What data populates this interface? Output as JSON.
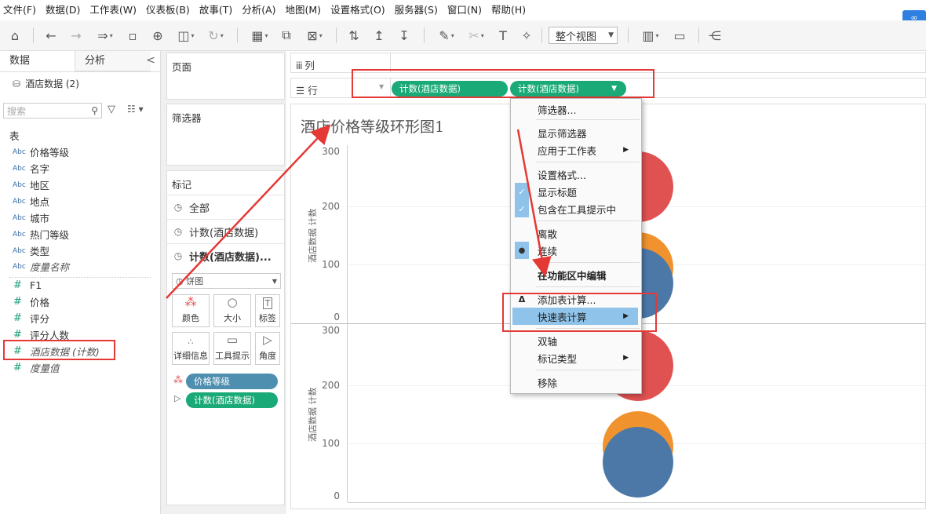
{
  "menubar": [
    "文件(F)",
    "数据(D)",
    "工作表(W)",
    "仪表板(B)",
    "故事(T)",
    "分析(A)",
    "地图(M)",
    "设置格式(O)",
    "服务器(S)",
    "窗口(N)",
    "帮助(H)"
  ],
  "toolbar": {
    "view_select": "整个视图",
    "icons": [
      "home-icon",
      "undo-icon",
      "redo-icon",
      "replay-icon",
      "save-icon",
      "new-datasource-icon",
      "datasource-icon",
      "refresh-icon",
      "new-worksheet-icon",
      "duplicate-icon",
      "clear-icon",
      "swap-icon",
      "sort-asc-icon",
      "sort-desc-icon",
      "highlight-icon",
      "attach-icon",
      "label-icon",
      "pin-icon",
      "showme-icon",
      "presentation-icon",
      "share-icon"
    ]
  },
  "leftpanel": {
    "tab_data": "数据",
    "tab_analysis": "分析",
    "collapse": "<",
    "datasource": "酒店数据 (2)",
    "search_placeholder": "搜索",
    "tables_label": "表",
    "dimensions": [
      {
        "type": "Abc",
        "name": "价格等级"
      },
      {
        "type": "Abc",
        "name": "名字"
      },
      {
        "type": "Abc",
        "name": "地区"
      },
      {
        "type": "Abc",
        "name": "地点"
      },
      {
        "type": "Abc",
        "name": "城市"
      },
      {
        "type": "Abc",
        "name": "热门等级"
      },
      {
        "type": "Abc",
        "name": "类型"
      },
      {
        "type": "Abc",
        "name": "度量名称"
      }
    ],
    "measures": [
      {
        "type": "#",
        "name": "F1"
      },
      {
        "type": "#",
        "name": "价格"
      },
      {
        "type": "#",
        "name": "评分"
      },
      {
        "type": "#",
        "name": "评分人数"
      },
      {
        "type": "#",
        "name": "酒店数据 (计数)"
      },
      {
        "type": "#",
        "name": "度量值"
      }
    ]
  },
  "shelves": {
    "pages": "页面",
    "filters": "筛选器",
    "marks": "标记",
    "marks_rows": [
      "全部",
      "计数(酒店数据)",
      "计数(酒店数据)..."
    ],
    "mark_type": "饼图",
    "mark_buttons": [
      "颜色",
      "大小",
      "标签",
      "详细信息",
      "工具提示",
      "角度"
    ],
    "mark_pills": [
      {
        "label": "价格等级",
        "color": "#4e8fb0"
      },
      {
        "label": "计数(酒店数据)",
        "color": "#1aaa77"
      }
    ],
    "columns_label": "列",
    "rows_label": "行",
    "row_pills": [
      "计数(酒店数据)",
      "计数(酒店数据)"
    ]
  },
  "view": {
    "title": "酒店价格等级环形图1",
    "axis_name": "酒店数据 计数",
    "ticks_top": [
      "300",
      "200",
      "100",
      "0"
    ],
    "ticks_bottom": [
      "300",
      "200",
      "100",
      "0"
    ]
  },
  "colors": {
    "red": "#e05252",
    "orange": "#f0922e",
    "blue": "#4c78a8",
    "green_pill": "#1aaa77",
    "highlight": "#8fc3ea",
    "annotation": "#e53935"
  },
  "context_menu": [
    {
      "label": "筛选器...",
      "mark": "",
      "sub": false
    },
    {
      "label": "显示筛选器",
      "mark": "",
      "sub": false
    },
    {
      "label": "应用于工作表",
      "mark": "",
      "sub": true
    },
    {
      "label": "设置格式...",
      "mark": "",
      "sub": false
    },
    {
      "label": "显示标题",
      "mark": "check",
      "sub": false
    },
    {
      "label": "包含在工具提示中",
      "mark": "check",
      "sub": false
    },
    {
      "label": "离散",
      "mark": "",
      "sub": false
    },
    {
      "label": "连续",
      "mark": "dot",
      "sub": false
    },
    {
      "label": "在功能区中编辑",
      "mark": "",
      "sub": false
    },
    {
      "label": "添加表计算...",
      "mark": "delta",
      "sub": false
    },
    {
      "label": "快速表计算",
      "mark": "",
      "sub": true
    },
    {
      "label": "双轴",
      "mark": "",
      "sub": false
    },
    {
      "label": "标记类型",
      "mark": "",
      "sub": true
    },
    {
      "label": "移除",
      "mark": "",
      "sub": false
    }
  ]
}
